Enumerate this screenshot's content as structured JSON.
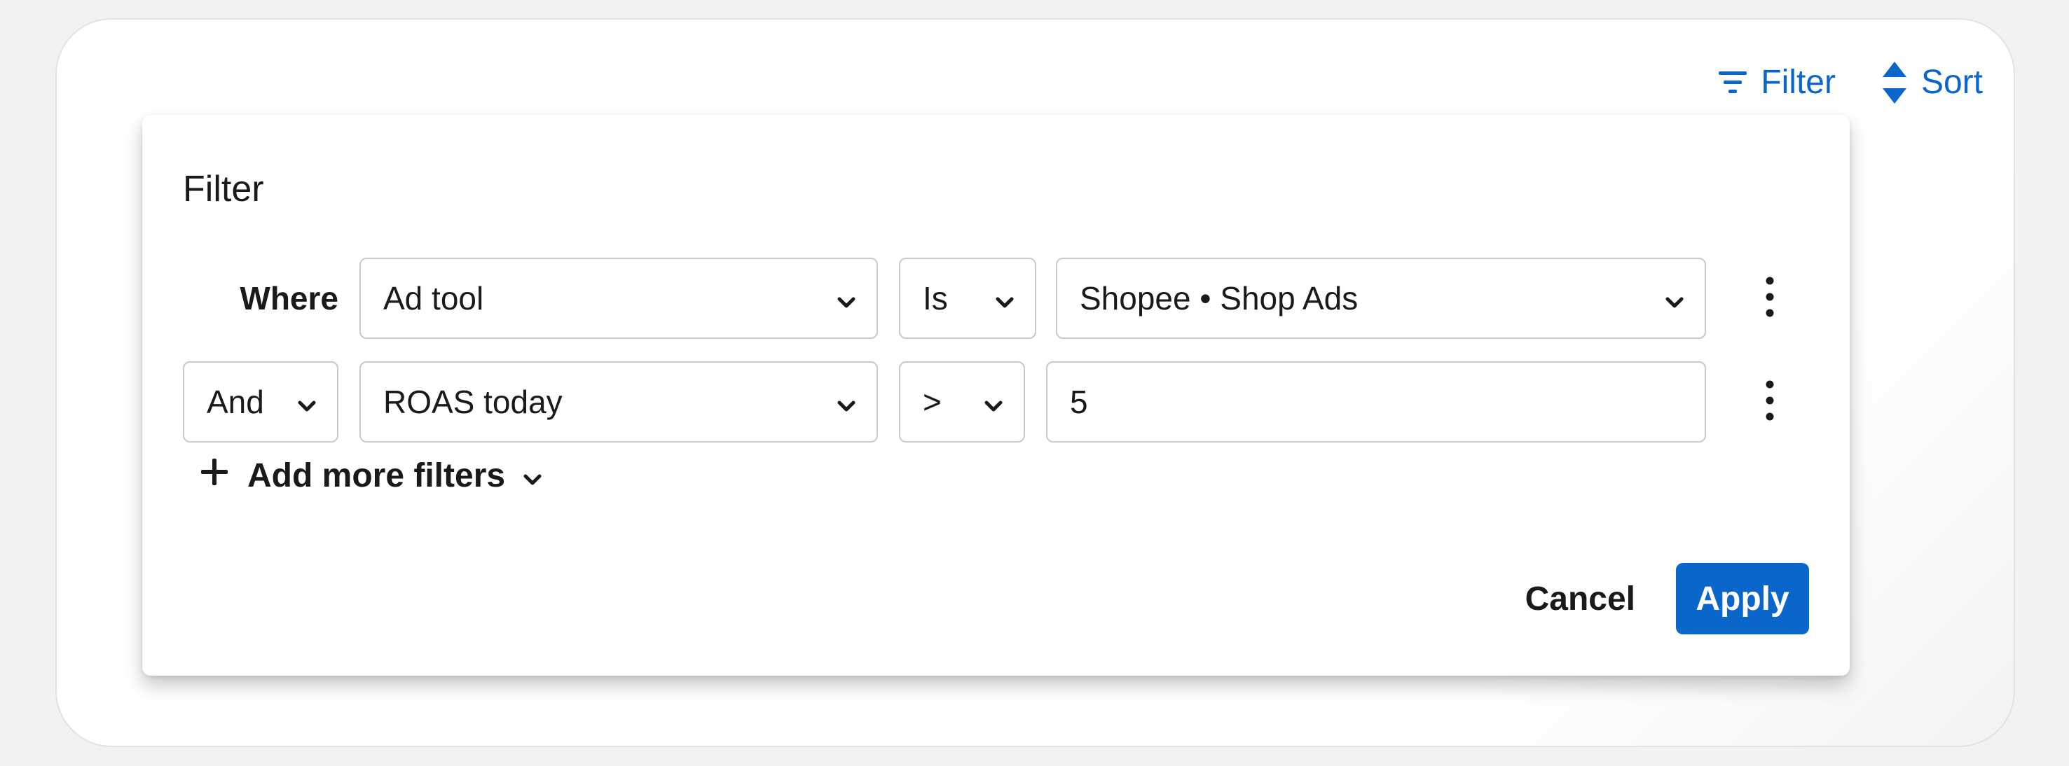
{
  "toolbar": {
    "filter_label": "Filter",
    "sort_label": "Sort",
    "accent_color": "#0a66c8"
  },
  "filter_panel": {
    "title": "Filter",
    "rows": [
      {
        "connector": "Where",
        "field": "Ad tool",
        "operator": "Is",
        "value": "Shopee • Shop Ads"
      },
      {
        "connector": "And",
        "field": "ROAS today",
        "operator": ">",
        "value": "5"
      }
    ],
    "add_more_label": "Add more filters",
    "cancel_label": "Cancel",
    "apply_label": "Apply"
  },
  "icons": {
    "filter": "filter-lines-icon",
    "sort": "sort-updown-icon",
    "chevron": "chevron-down-icon",
    "kebab": "kebab-menu-icon",
    "plus": "plus-icon"
  }
}
